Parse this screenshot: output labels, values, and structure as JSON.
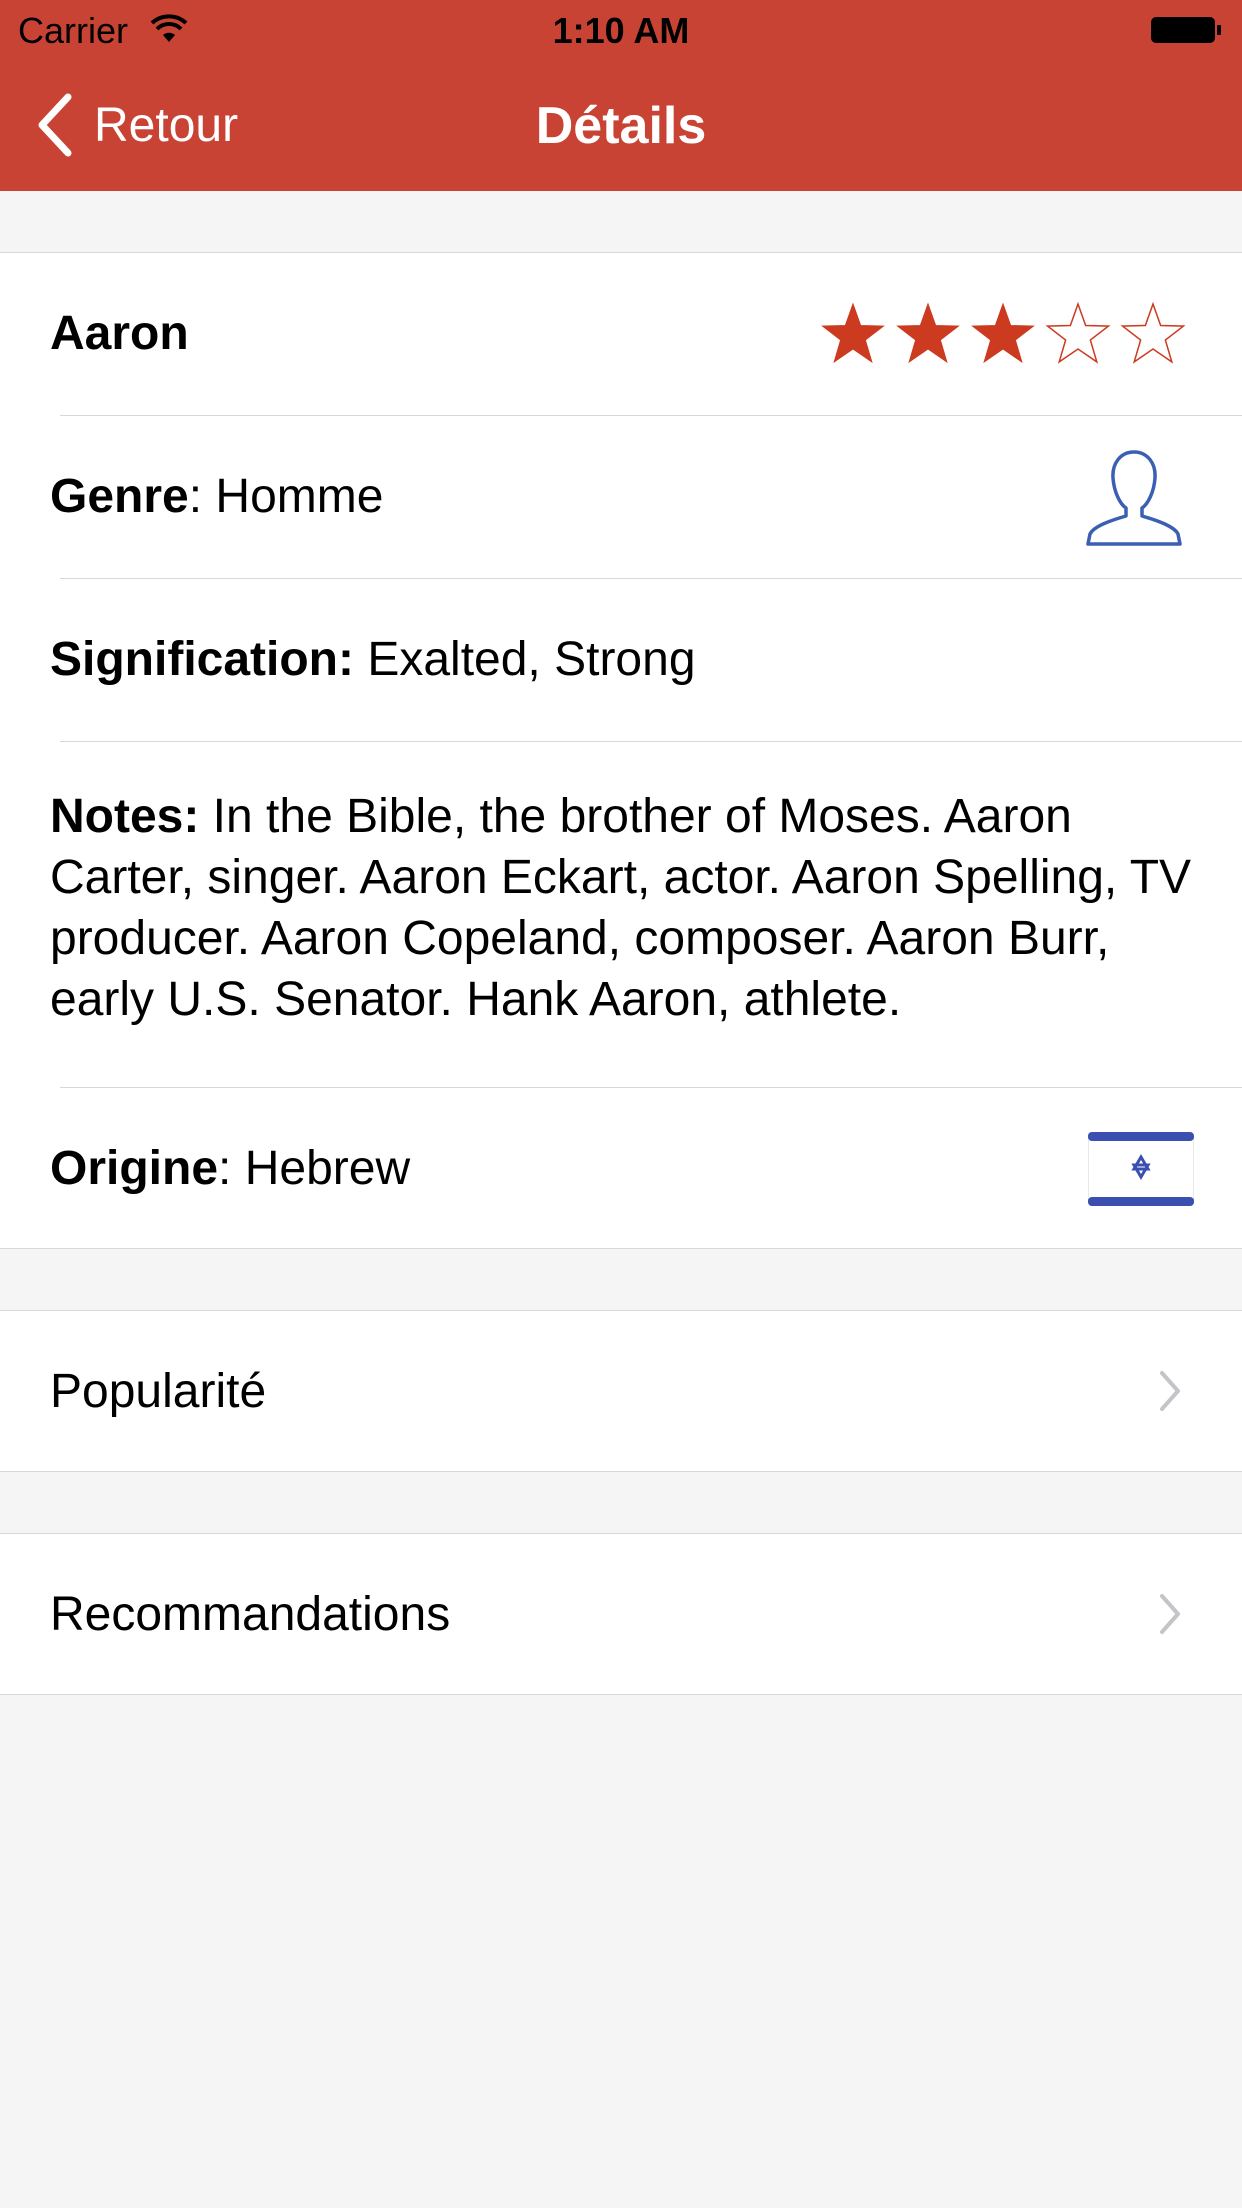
{
  "status_bar": {
    "carrier": "Carrier",
    "time": "1:10 AM"
  },
  "nav": {
    "back_label": "Retour",
    "title": "Détails"
  },
  "details": {
    "name": "Aaron",
    "rating": 3,
    "rating_max": 5,
    "gender_label": "Genre",
    "gender_value": ": Homme",
    "meaning_label": "Signification:",
    "meaning_value": " Exalted, Strong",
    "notes_label": "Notes:",
    "notes_value": " In the Bible, the brother of Moses.  Aaron Carter, singer. Aaron Eckart, actor. Aaron Spelling, TV producer. Aaron Copeland, composer. Aaron Burr, early U.S. Senator. Hank Aaron, athlete.",
    "origin_label": "Origine",
    "origin_value": ": Hebrew"
  },
  "links": {
    "popularity": "Popularité",
    "recommendations": "Recommandations"
  },
  "colors": {
    "accent": "#c94335",
    "star_filled": "#cc3a1f",
    "icon_blue": "#3a5fb3"
  },
  "icons": {
    "back": "chevron-left-icon",
    "star": "star-icon",
    "gender": "person-icon",
    "flag": "israel-flag-icon",
    "disclosure": "chevron-right-icon"
  }
}
